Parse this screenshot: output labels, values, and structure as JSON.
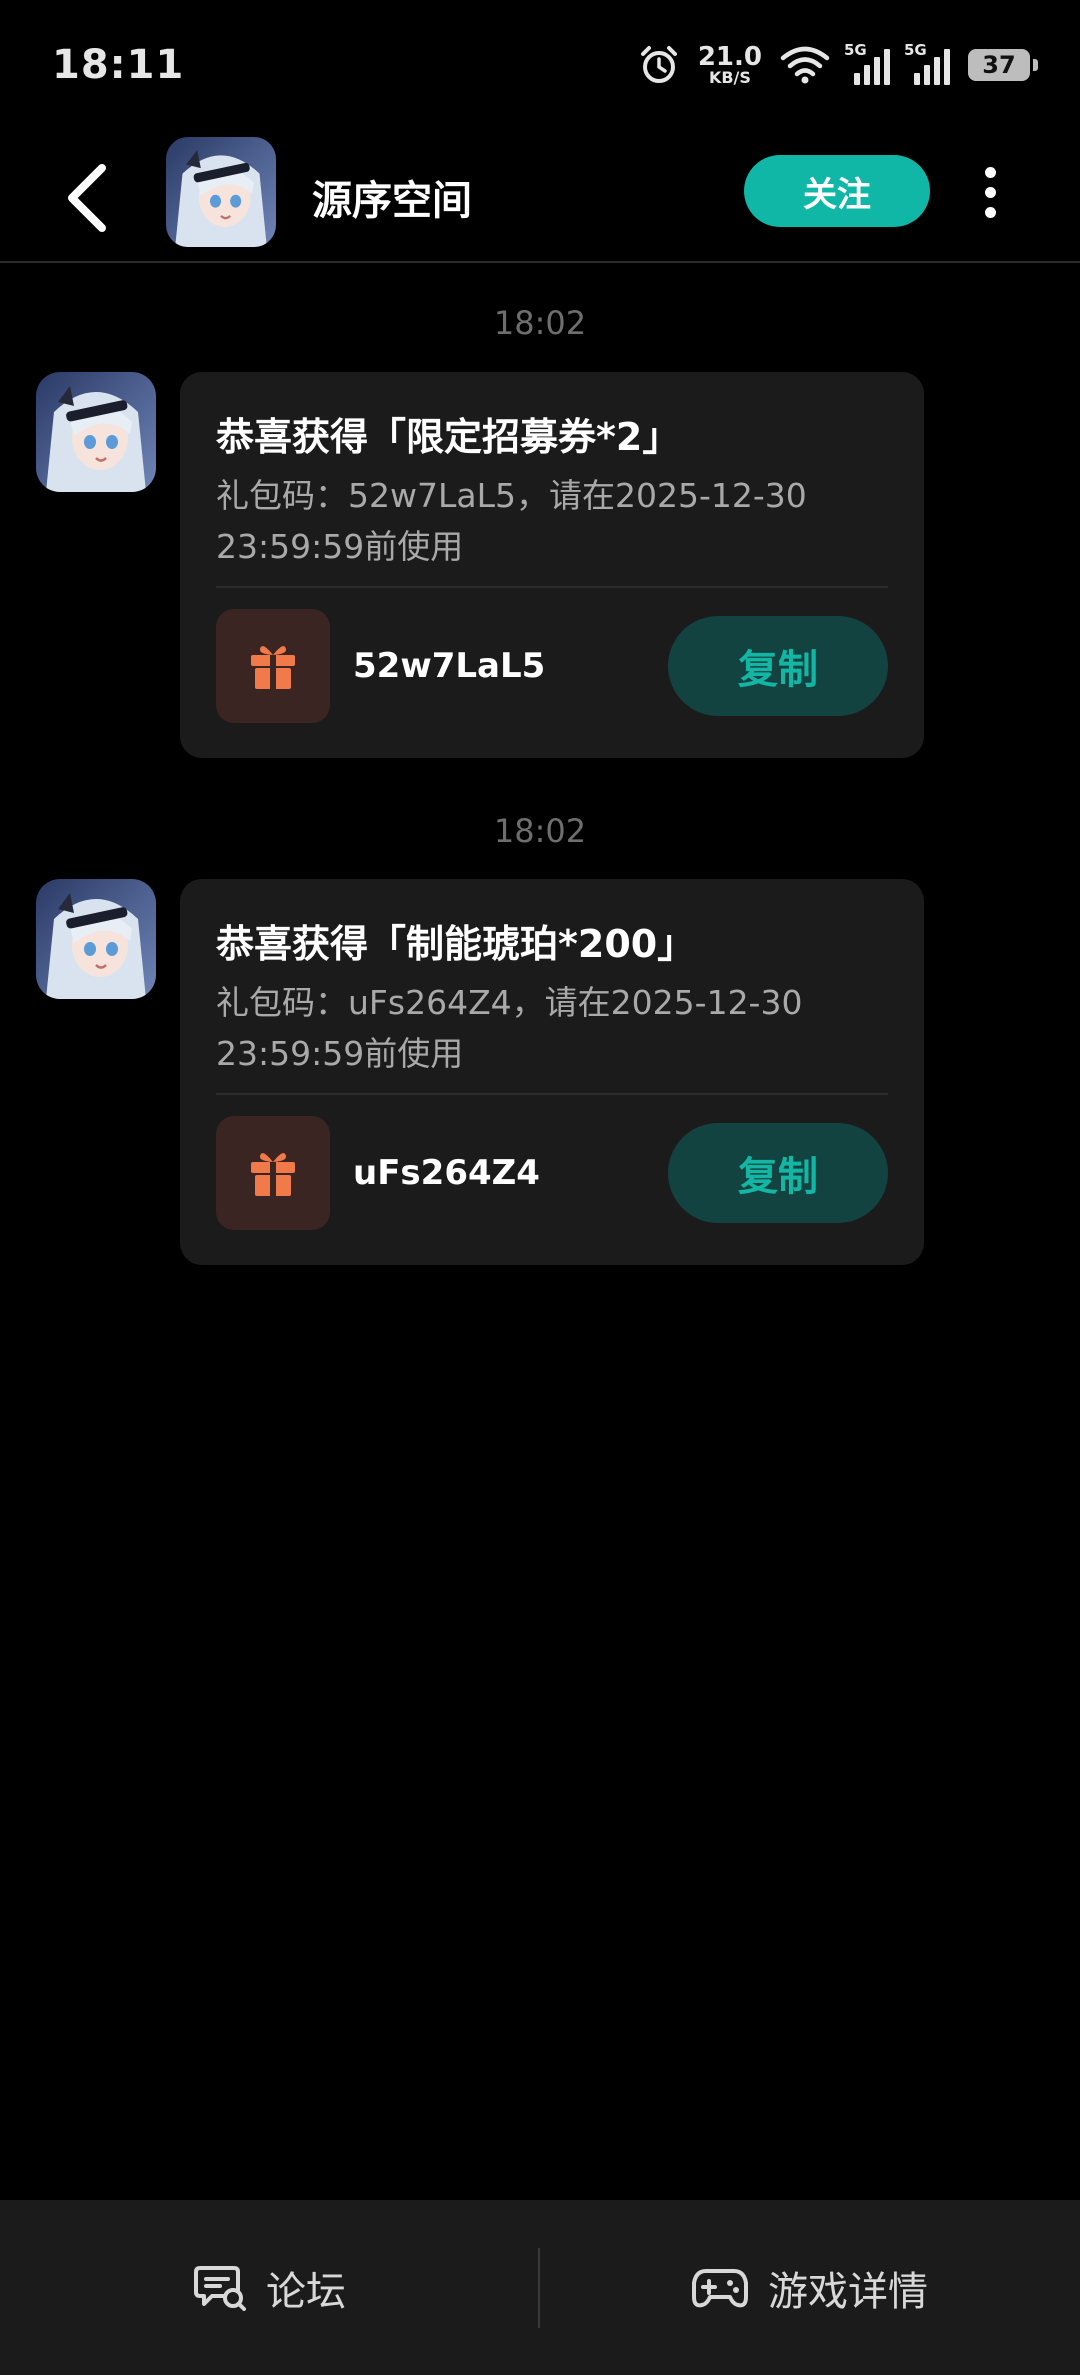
{
  "status_bar": {
    "time": "18:11",
    "net_speed_value": "21.0",
    "net_speed_unit": "KB/S",
    "signal1_label": "5G",
    "signal2_label": "5G",
    "battery": "37"
  },
  "header": {
    "title": "源序空间",
    "follow_label": "关注"
  },
  "messages": [
    {
      "time": "18:02",
      "title": "恭喜获得「限定招募券*2」",
      "desc": "礼包码：52w7LaL5，请在2025-12-30 23:59:59前使用",
      "code": "52w7LaL5",
      "copy_label": "复制"
    },
    {
      "time": "18:02",
      "title": "恭喜获得「制能琥珀*200」",
      "desc": "礼包码：uFs264Z4，请在2025-12-30 23:59:59前使用",
      "code": "uFs264Z4",
      "copy_label": "复制"
    }
  ],
  "bottom_bar": {
    "forum_label": "论坛",
    "game_detail_label": "游戏详情"
  },
  "colors": {
    "accent": "#11b7a6",
    "copy_bg": "#134340",
    "gift_bg": "#3a2522",
    "gift_icon": "#f07a4a",
    "card_bg": "#1b1b1b"
  },
  "icons": [
    "chevron-left-icon",
    "more-vertical-icon",
    "alarm-icon",
    "wifi-icon",
    "gift-icon",
    "forum-icon",
    "gamepad-icon"
  ]
}
